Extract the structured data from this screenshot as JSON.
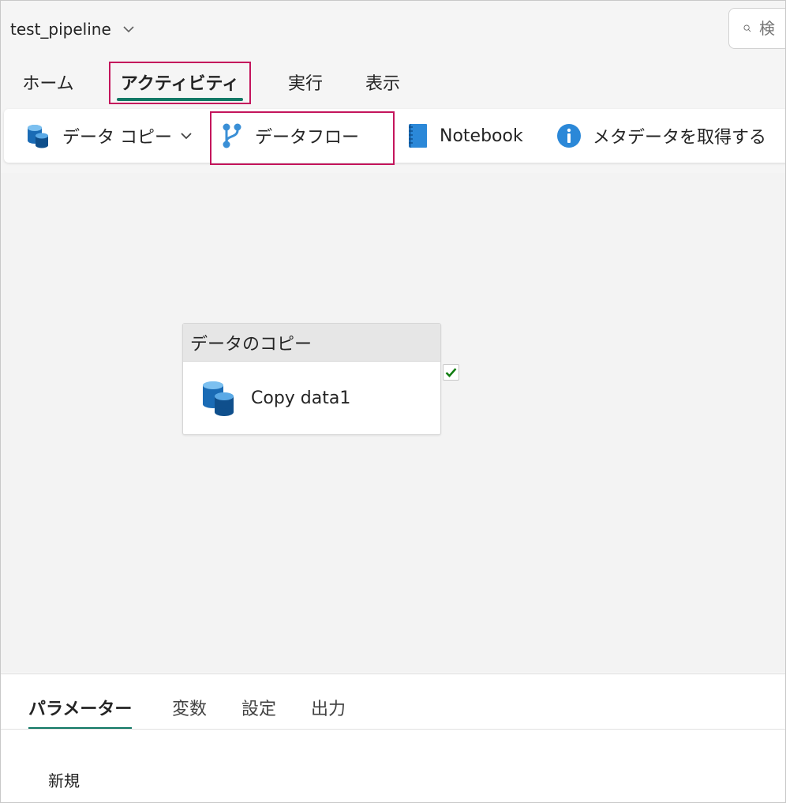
{
  "header": {
    "pipeline_name": "test_pipeline",
    "search_placeholder": "検"
  },
  "ribbon": {
    "tabs": [
      {
        "label": "ホーム",
        "active": false
      },
      {
        "label": "アクティビティ",
        "active": true
      },
      {
        "label": "実行",
        "active": false
      },
      {
        "label": "表示",
        "active": false
      }
    ]
  },
  "toolbar": {
    "copy_data": "データ コピー",
    "dataflow": "データフロー",
    "notebook": "Notebook",
    "get_metadata": "メタデータを取得する"
  },
  "canvas": {
    "activity": {
      "category": "データのコピー",
      "name": "Copy data1"
    }
  },
  "bottom_panel": {
    "tabs": [
      {
        "label": "パラメーター",
        "active": true
      },
      {
        "label": "変数",
        "active": false
      },
      {
        "label": "設定",
        "active": false
      },
      {
        "label": "出力",
        "active": false
      }
    ],
    "new_label": "新規"
  },
  "colors": {
    "accent": "#117865",
    "highlight": "#c4155c",
    "icon_blue": "#1a6bb5",
    "check_green": "#107c10"
  }
}
